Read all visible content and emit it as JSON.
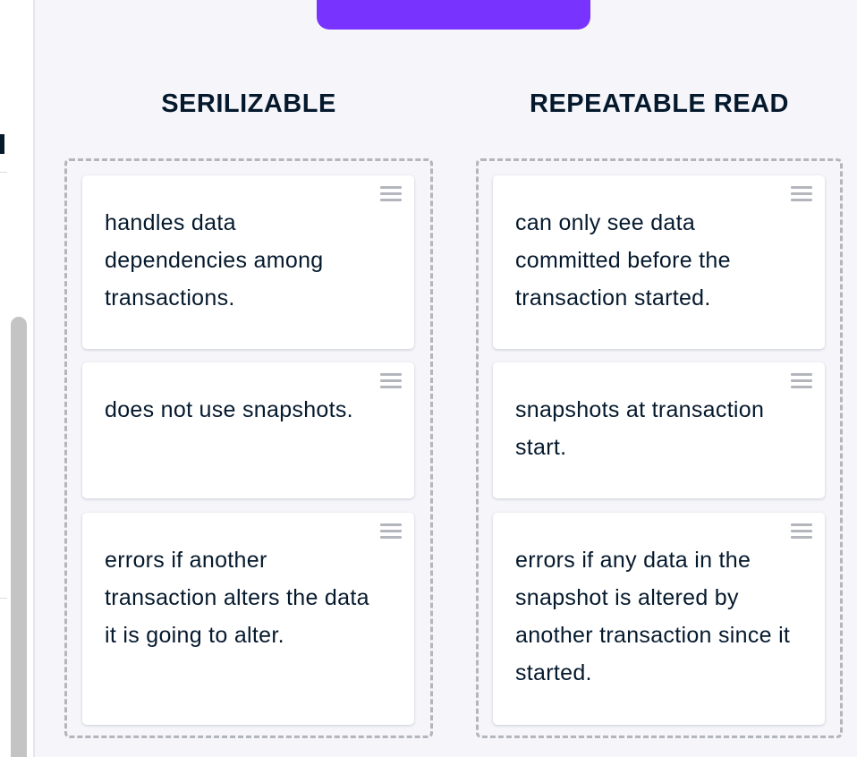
{
  "columns": [
    {
      "title": "SERILIZABLE",
      "cards": [
        "handles data dependencies among transactions.",
        "does not use snapshots.",
        "errors if another transaction alters the data it is going to alter."
      ]
    },
    {
      "title": "REPEATABLE READ",
      "cards": [
        "can only see data committed before the transaction started.",
        "snapshots at transaction start.",
        "errors if any data in the snapshot is altered by another transaction since it started."
      ]
    }
  ],
  "icons": {
    "drag_handle": "drag-handle-icon"
  },
  "colors": {
    "accent": "#7933ff",
    "text": "#05192d",
    "background": "#f5f5fa",
    "dashed_border": "#b4b6bd"
  }
}
